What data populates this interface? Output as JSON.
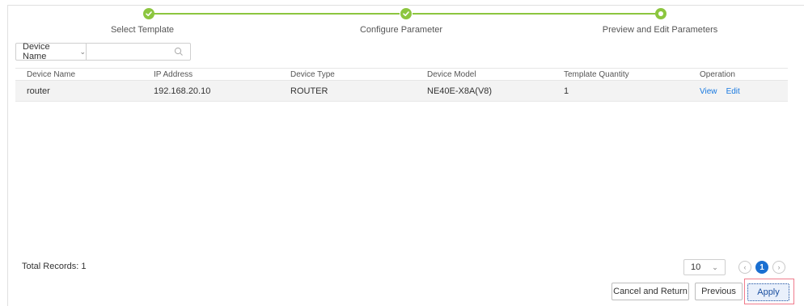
{
  "stepper": {
    "steps": [
      {
        "label": "Select Template",
        "status": "completed"
      },
      {
        "label": "Configure Parameter",
        "status": "completed"
      },
      {
        "label": "Preview and Edit Parameters",
        "status": "current"
      }
    ],
    "color": "#8cc63f"
  },
  "filter": {
    "field_label": "Device Name",
    "search_value": "",
    "search_placeholder": ""
  },
  "table": {
    "columns": [
      "Device Name",
      "IP Address",
      "Device Type",
      "Device Model",
      "Template Quantity",
      "Operation"
    ],
    "rows": [
      {
        "device_name": "router",
        "ip_address": "192.168.20.10",
        "device_type": "ROUTER",
        "device_model": "NE40E-X8A(V8)",
        "template_quantity": "1",
        "actions": [
          "View",
          "Edit"
        ]
      }
    ]
  },
  "pagination": {
    "total_records": "Total Records: 1",
    "page_size": "10",
    "current_page": "1",
    "accent": "#1a6fd1"
  },
  "buttons": {
    "cancel": "Cancel and Return",
    "previous": "Previous",
    "apply": "Apply"
  }
}
